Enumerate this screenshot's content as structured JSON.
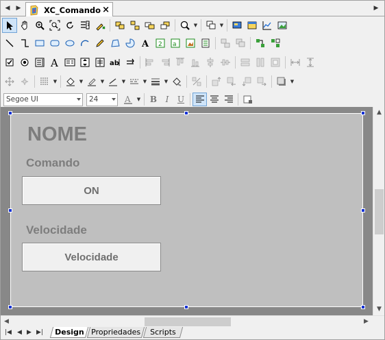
{
  "document_tab": {
    "title": "XC_Comando",
    "close": "×"
  },
  "font": {
    "family": "Segoe UI",
    "size": "24"
  },
  "format_buttons": {
    "bold": "B",
    "italic": "I",
    "underline": "U"
  },
  "form": {
    "title": "NOME",
    "comando_label": "Comando",
    "on_button": "ON",
    "velocidade_label": "Velocidade",
    "velocidade_button": "Velocidade"
  },
  "bottom_tabs": [
    {
      "label": "Design",
      "active": true
    },
    {
      "label": "Propriedades",
      "active": false
    },
    {
      "label": "Scripts",
      "active": false
    }
  ],
  "colors": {
    "selection_handle": "#1733d6",
    "form_bg": "#bfbfbf",
    "canvas_bg": "#888888"
  }
}
